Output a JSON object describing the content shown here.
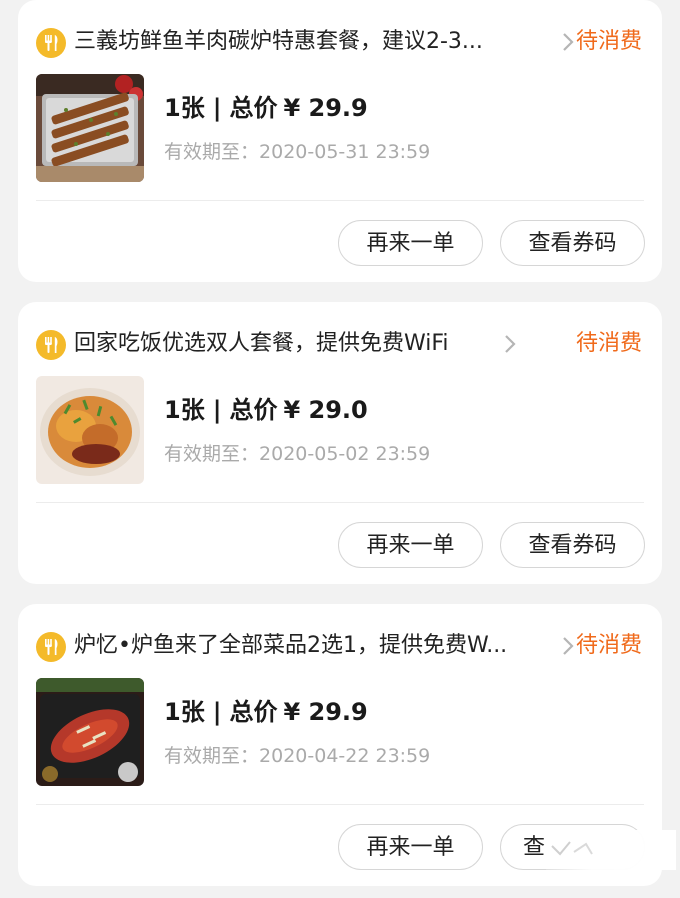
{
  "orders": [
    {
      "shop_name": "三義坊鲜鱼羊肉碳炉特惠套餐，建议2-3...",
      "status": "待消费",
      "quantity": "1张",
      "separator": "|",
      "total_label": "总价",
      "price": "¥ 29.9",
      "validity_label": "有效期至：",
      "validity_date": "2020-05-31 23:59",
      "reorder_label": "再来一单",
      "voucher_label": "查看券码",
      "image_icon": "grilled-skewers-photo"
    },
    {
      "shop_name": "回家吃饭优选双人套餐，提供免费WiFi",
      "status": "待消费",
      "quantity": "1张",
      "separator": "|",
      "total_label": "总价",
      "price": "¥ 29.0",
      "validity_label": "有效期至：",
      "validity_date": "2020-05-02 23:59",
      "reorder_label": "再来一单",
      "voucher_label": "查看券码",
      "image_icon": "braised-dish-photo"
    },
    {
      "shop_name": "炉忆•炉鱼来了全部菜品2选1，提供免费W...",
      "status": "待消费",
      "quantity": "1张",
      "separator": "|",
      "total_label": "总价",
      "price": "¥ 29.9",
      "validity_label": "有效期至：",
      "validity_date": "2020-04-22 23:59",
      "reorder_label": "再来一单",
      "voucher_label": "查",
      "image_icon": "grilled-fish-photo"
    }
  ],
  "colors": {
    "status": "#f06a1b",
    "shop_icon": "#f4ba2a",
    "background": "#f2f2f2"
  },
  "icons": {
    "shop": "fork-knife-icon",
    "arrow": "chevron-right-icon"
  }
}
